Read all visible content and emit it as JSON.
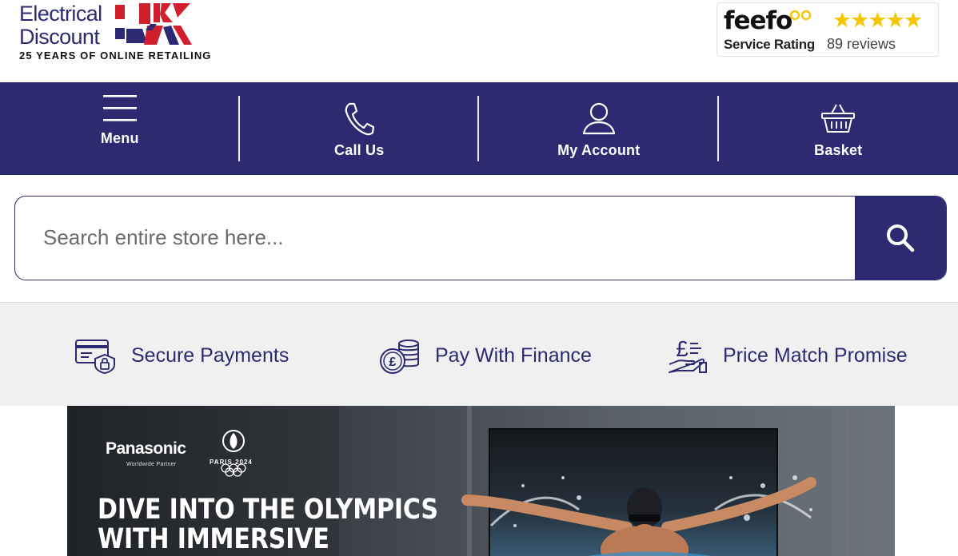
{
  "header": {
    "logo": {
      "line1": "Electrical",
      "line2": "Discount",
      "tagline": "25 YEARS OF ONLINE RETAILING"
    },
    "feefo": {
      "brand": "feefo",
      "stars": "★★★★★",
      "label": "Service Rating",
      "reviews": "89 reviews"
    }
  },
  "nav": {
    "items": [
      {
        "label": "Menu",
        "icon": "hamburger-icon"
      },
      {
        "label": "Call Us",
        "icon": "phone-icon"
      },
      {
        "label": "My Account",
        "icon": "user-icon"
      },
      {
        "label": "Basket",
        "icon": "basket-icon"
      }
    ]
  },
  "search": {
    "placeholder": "Search entire store here...",
    "value": "",
    "button_icon": "search-icon"
  },
  "usp": {
    "items": [
      {
        "label": "Secure Payments",
        "icon": "secure-card-icon"
      },
      {
        "label": "Pay With Finance",
        "icon": "coins-icon"
      },
      {
        "label": "Price Match Promise",
        "icon": "pound-hand-icon"
      }
    ]
  },
  "banner": {
    "brand": "Panasonic",
    "brand_sub": "Worldwide Partner",
    "event": "PARIS 2024",
    "headline_line1": "DIVE INTO THE OLYMPICS",
    "headline_line2": "WITH IMMERSIVE"
  },
  "colors": {
    "brand_navy": "#2d2a72",
    "uk_red": "#d0202e",
    "feefo_gold": "#f7c600",
    "usp_bg": "#f0f0f0"
  }
}
